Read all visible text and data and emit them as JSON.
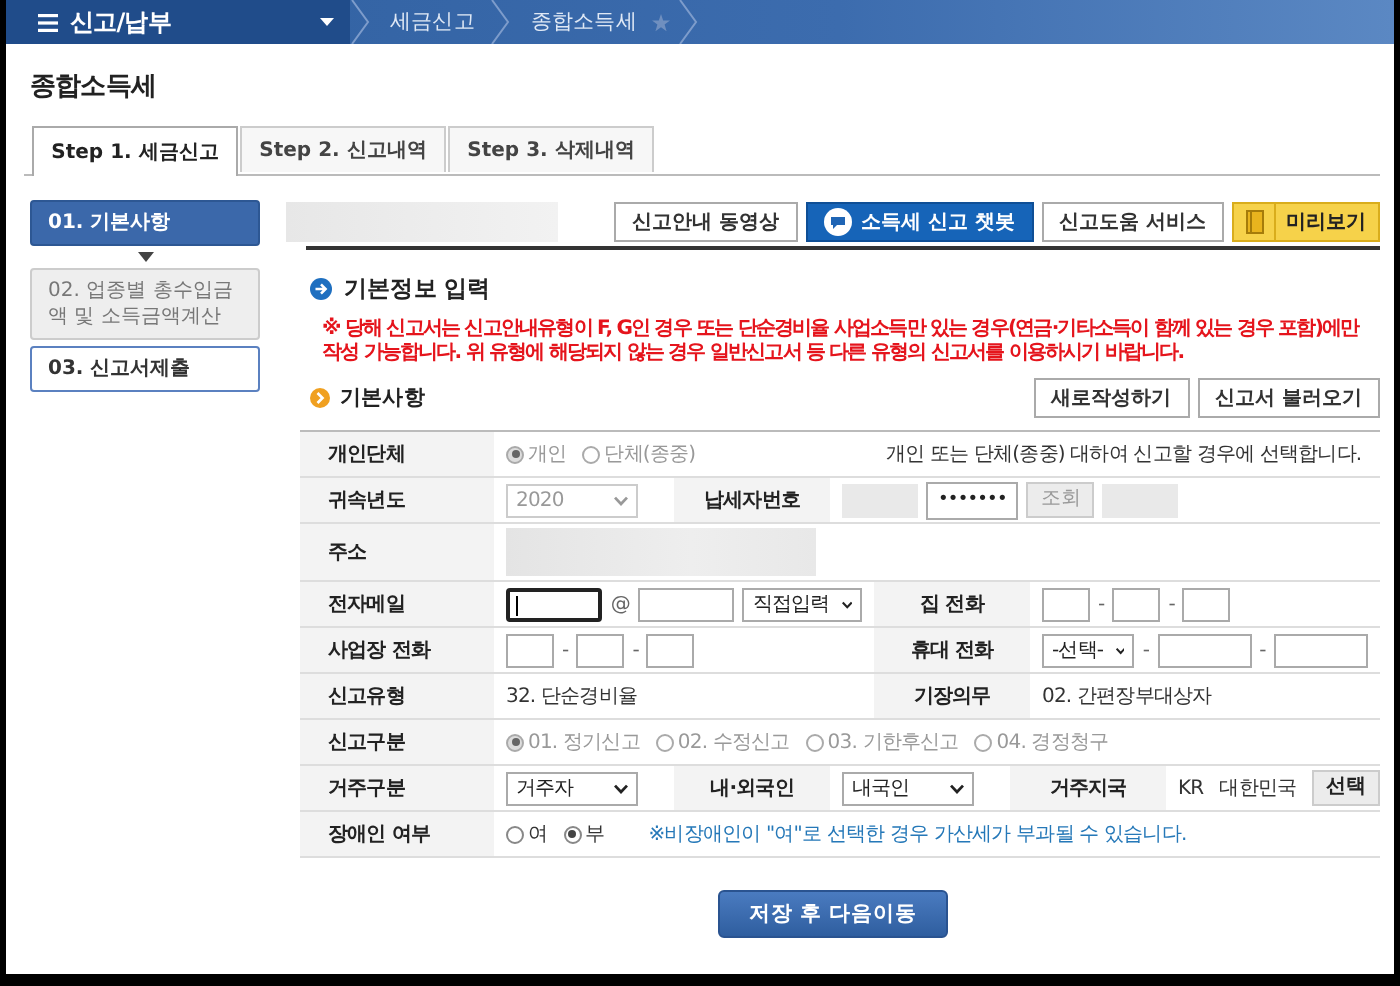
{
  "nav": {
    "menu": "신고/납부",
    "breadcrumbs": [
      "세금신고",
      "종합소득세"
    ]
  },
  "page_title": "종합소득세",
  "tabs": [
    {
      "label": "Step 1. 세금신고",
      "selected": true
    },
    {
      "label": "Step 2. 신고내역",
      "selected": false
    },
    {
      "label": "Step 3. 삭제내역",
      "selected": false
    }
  ],
  "steps": [
    {
      "label": "01. 기본사항",
      "selected": true,
      "disabled": false
    },
    {
      "label": "02. 업종별 총수입금액 및 소득금액계산",
      "selected": false,
      "disabled": true
    },
    {
      "label": "03. 신고서제출",
      "selected": false,
      "disabled": false
    }
  ],
  "toolbar": {
    "masked": true,
    "buttons": [
      {
        "kind": "plain",
        "label": "신고안내 동영상"
      },
      {
        "kind": "chatbot",
        "label": "소득세 신고 챗봇"
      },
      {
        "kind": "plain",
        "label": "신고도움 서비스"
      },
      {
        "kind": "preview",
        "label": "미리보기"
      }
    ]
  },
  "section_title": "기본정보 입력",
  "notice": "※ 당해 신고서는 신고안내유형이 F, G인 경우 또는 단순경비율 사업소득만 있는 경우(연금·기타소득이 함께 있는 경우 포함)에만 작성 가능합니다. 위 유형에 해당되지 않는 경우 일반신고서 등 다른 유형의 신고서를 이용하시기 바랍니다.",
  "subsection": {
    "title": "기본사항",
    "buttons": [
      "새로작성하기",
      "신고서 불러오기"
    ]
  },
  "form_rows": [
    {
      "cells": [
        {
          "label": "개인단체"
        },
        {
          "items": [
            {
              "kind": "radio",
              "label": "개인",
              "selected": true,
              "disabled": true
            },
            {
              "kind": "radio",
              "label": "단체(종중)",
              "selected": false,
              "disabled": true
            }
          ]
        },
        {
          "items": [
            {
              "kind": "text",
              "text": "개인 또는 단체(종중) 대하여 신고할 경우에 선택합니다."
            }
          ]
        }
      ]
    },
    {
      "cells": [
        {
          "label": "귀속년도"
        },
        {
          "items": [
            {
              "kind": "select",
              "value": "2020",
              "disabled": true
            }
          ]
        },
        {
          "label": "납세자번호"
        },
        {
          "items": [
            {
              "kind": "blurred"
            },
            {
              "kind": "password",
              "value": "•••••••"
            },
            {
              "kind": "button",
              "text": "조회",
              "disabled": true
            },
            {
              "kind": "blurred"
            }
          ]
        }
      ]
    },
    {
      "cells": [
        {
          "label": "주소"
        },
        {
          "items": [
            {
              "kind": "blurred"
            }
          ]
        }
      ]
    },
    {
      "cells": [
        {
          "label": "전자메일"
        },
        {
          "items": [
            {
              "kind": "input",
              "focused": true
            },
            {
              "kind": "sep",
              "text": "@"
            },
            {
              "kind": "input",
              "focused": false
            },
            {
              "kind": "select",
              "value": "직접입력",
              "disabled": false
            }
          ]
        },
        {
          "label": "집 전화"
        },
        {
          "items": [
            {
              "kind": "input",
              "focused": false
            },
            {
              "kind": "sep",
              "text": "-"
            },
            {
              "kind": "input",
              "focused": false
            },
            {
              "kind": "sep",
              "text": "-"
            },
            {
              "kind": "input",
              "focused": false
            }
          ]
        }
      ]
    },
    {
      "cells": [
        {
          "label": "사업장 전화"
        },
        {
          "items": [
            {
              "kind": "input",
              "focused": false
            },
            {
              "kind": "sep",
              "text": "-"
            },
            {
              "kind": "input",
              "focused": false
            },
            {
              "kind": "sep",
              "text": "-"
            },
            {
              "kind": "input",
              "focused": false
            }
          ]
        },
        {
          "label": "휴대 전화"
        },
        {
          "items": [
            {
              "kind": "select",
              "value": "-선택-",
              "disabled": false
            },
            {
              "kind": "sep",
              "text": "-"
            },
            {
              "kind": "input",
              "focused": false
            },
            {
              "kind": "sep",
              "text": "-"
            },
            {
              "kind": "input",
              "focused": false
            }
          ]
        }
      ]
    },
    {
      "cells": [
        {
          "label": "신고유형"
        },
        {
          "items": [
            {
              "kind": "text",
              "text": "32. 단순경비율"
            }
          ]
        },
        {
          "label": "기장의무"
        },
        {
          "items": [
            {
              "kind": "text",
              "text": "02. 간편장부대상자"
            }
          ]
        }
      ]
    },
    {
      "cells": [
        {
          "label": "신고구분"
        },
        {
          "items": [
            {
              "kind": "radio",
              "label": "01. 정기신고",
              "selected": true,
              "disabled": true
            },
            {
              "kind": "radio",
              "label": "02. 수정신고",
              "selected": false,
              "disabled": true
            },
            {
              "kind": "radio",
              "label": "03. 기한후신고",
              "selected": false,
              "disabled": true
            },
            {
              "kind": "radio",
              "label": "04. 경정청구",
              "selected": false,
              "disabled": true
            }
          ]
        }
      ]
    },
    {
      "cells": [
        {
          "label": "거주구분"
        },
        {
          "items": [
            {
              "kind": "select",
              "value": "거주자",
              "disabled": false
            }
          ]
        },
        {
          "label": "내·외국인"
        },
        {
          "items": [
            {
              "kind": "select",
              "value": "내국인",
              "disabled": false
            }
          ]
        },
        {
          "label": "거주지국"
        },
        {
          "items": [
            {
              "kind": "text",
              "text": "KR"
            },
            {
              "kind": "text",
              "text": "대한민국"
            },
            {
              "kind": "button",
              "text": "선택",
              "disabled": false
            }
          ]
        }
      ]
    },
    {
      "cells": [
        {
          "label": "장애인 여부"
        },
        {
          "items": [
            {
              "kind": "radio",
              "label": "여",
              "selected": false,
              "disabled": false
            },
            {
              "kind": "radio",
              "label": "부",
              "selected": true,
              "disabled": false
            },
            {
              "kind": "note",
              "text": "※비장애인이 \"여\"로 선택한 경우 가산세가 부과될 수 있습니다."
            }
          ]
        }
      ]
    }
  ],
  "submit_button": "저장 후 다음이동"
}
